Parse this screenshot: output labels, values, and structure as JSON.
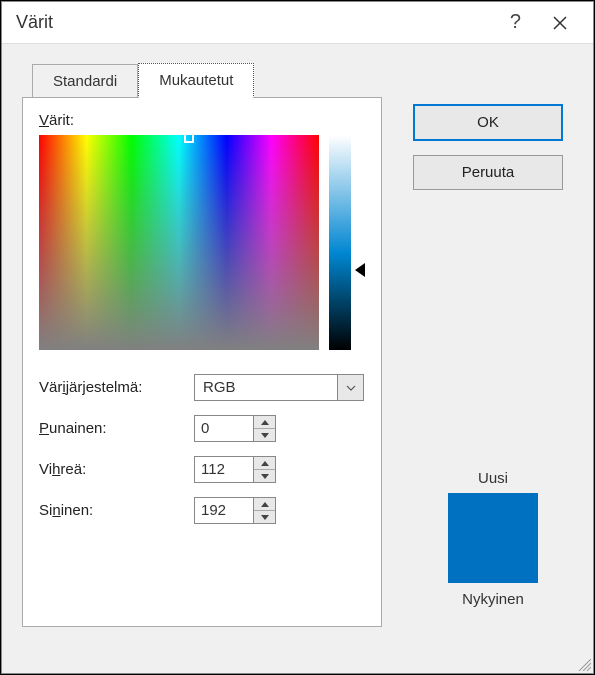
{
  "title": "Värit",
  "buttons": {
    "ok": "OK",
    "cancel": "Peruuta"
  },
  "tabs": {
    "standard": "Standardi",
    "custom": "Mukautetut"
  },
  "labels": {
    "colors": "Värit:",
    "model": "Värijärjestelmä:",
    "red": "Punainen:",
    "green": "Vihreä:",
    "blue": "Sininen:",
    "new": "Uusi",
    "current": "Nykyinen"
  },
  "values": {
    "model": "RGB",
    "red": "0",
    "green": "112",
    "blue": "192"
  },
  "colors": {
    "new": "#0070c0",
    "current": "#0070c0"
  }
}
